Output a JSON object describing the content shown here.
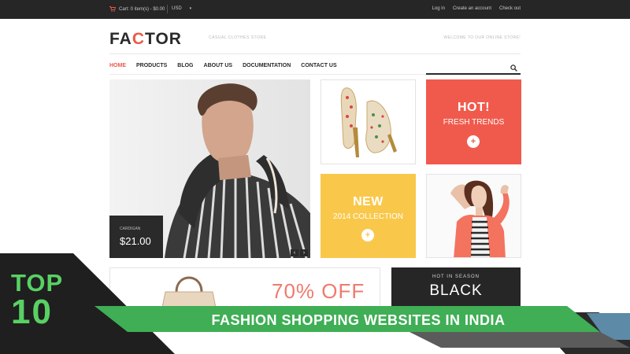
{
  "topbar": {
    "cart_text": "Cart: 0 item(s) - $0.00",
    "currency": "USD",
    "links": [
      "Log in",
      "Create an account",
      "Check out"
    ]
  },
  "header": {
    "logo_prefix": "FA",
    "logo_highlight": "C",
    "logo_suffix": "TOR",
    "tagline": "CASUAL CLOTHES STORE",
    "welcome": "WELCOME TO OUR ONLINE STORE!"
  },
  "nav": {
    "items": [
      "HOME",
      "PRODUCTS",
      "BLOG",
      "ABOUT US",
      "DOCUMENTATION",
      "CONTACT US"
    ],
    "active": "HOME"
  },
  "hero": {
    "price_label": "CARDIGAN",
    "price": "$21.00",
    "prev": "‹",
    "next": "›"
  },
  "tiles": {
    "hot_title": "HOT!",
    "hot_sub": "FRESH TRENDS",
    "new_title": "NEW",
    "new_sub": "2014 COLLECTION",
    "plus": "+"
  },
  "bottom": {
    "offer": "70% OFF",
    "season_label": "HOT IN SEASON",
    "season_big": "BLACK"
  },
  "overlay": {
    "top_word": "TOP",
    "top_number": "10",
    "banner": "FASHION SHOPPING WEBSITES IN INDIA"
  },
  "colors": {
    "accent_red": "#e85a4a",
    "hot_tile": "#f05a4d",
    "new_tile": "#f9c84b",
    "banner_green": "#3fae55",
    "overlay_dark": "#1f1f1f"
  }
}
